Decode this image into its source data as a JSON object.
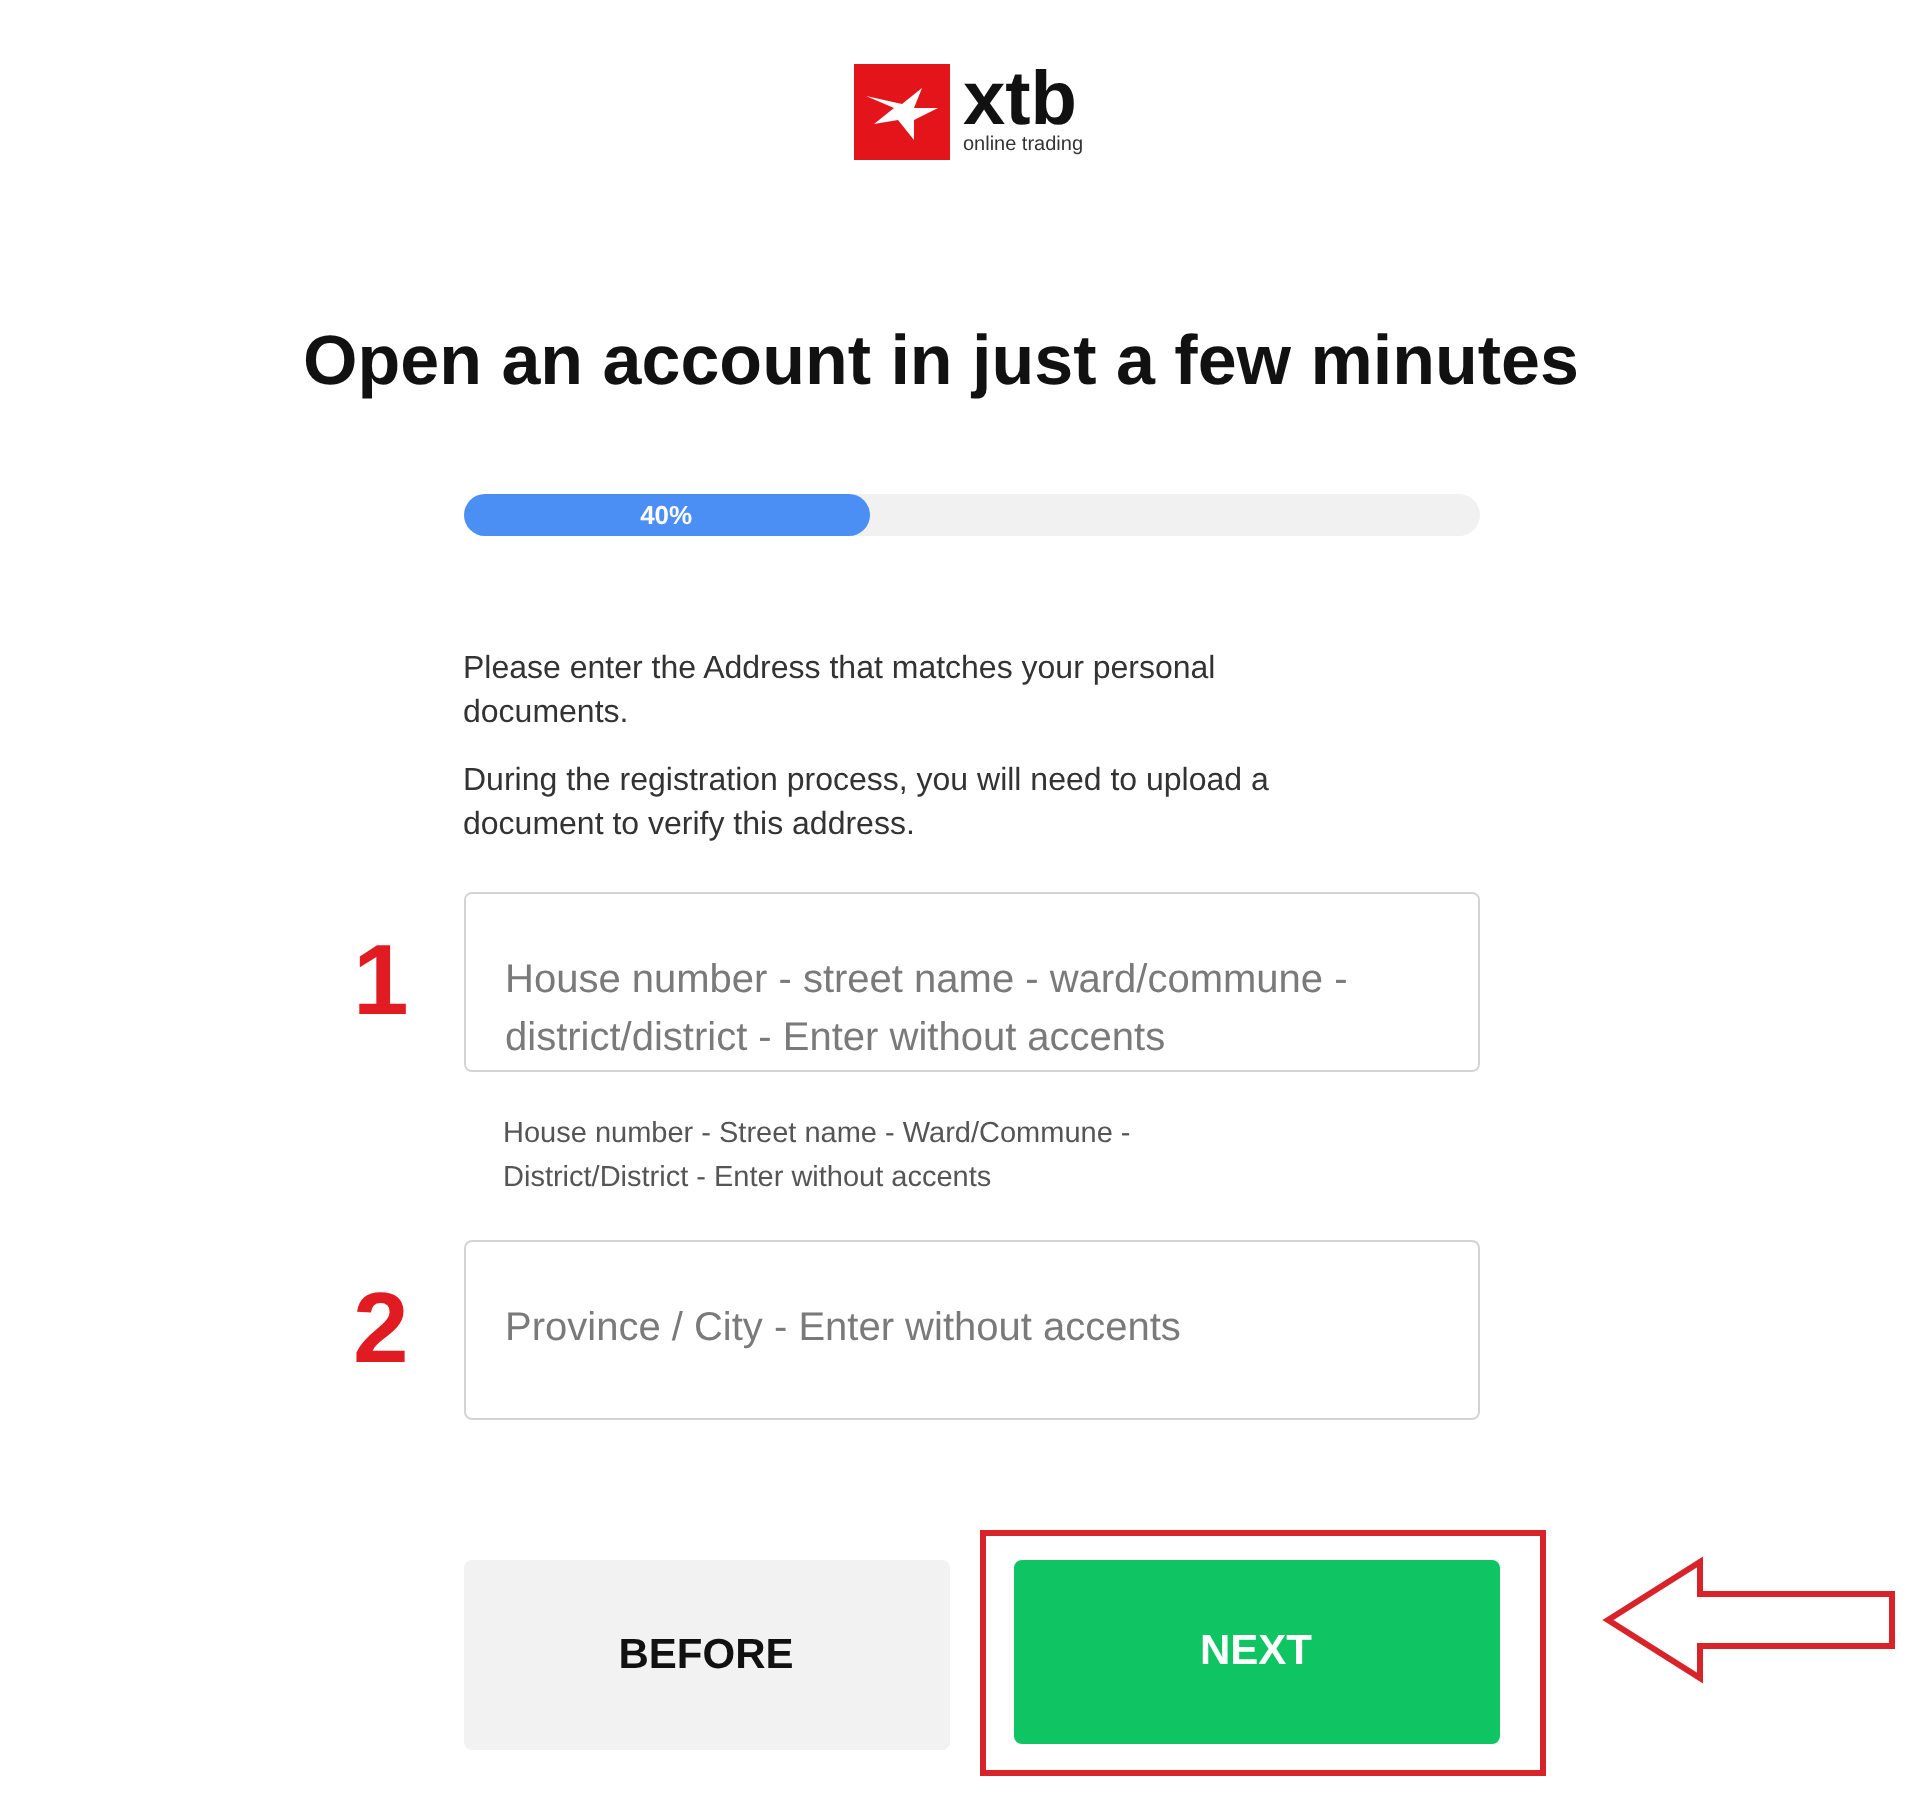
{
  "logo": {
    "name": "xtb",
    "tagline": "online trading"
  },
  "title": "Open an account in just a few minutes",
  "progress": {
    "level": 0.4,
    "label": "40%"
  },
  "intro": [
    "Please enter the Address that matches your personal documents.",
    "During the registration process, you will need to upload a document to verify this address."
  ],
  "fields": [
    {
      "marker": "1",
      "placeholder": "House number - street name - ward/commune - district/district - Enter without accents",
      "hint": "House number - Street name - Ward/Commune - District/District - Enter without accents"
    },
    {
      "marker": "2",
      "placeholder": "Province / City - Enter without accents"
    }
  ],
  "buttons": [
    {
      "label": "BEFORE",
      "kind": "secondary",
      "highlighted": false
    },
    {
      "label": "NEXT",
      "kind": "primary",
      "highlighted": true
    }
  ]
}
